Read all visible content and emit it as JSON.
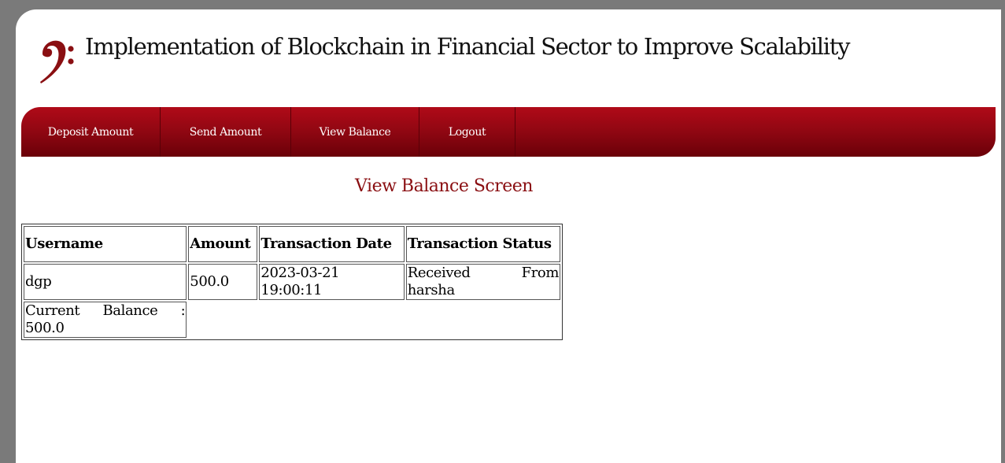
{
  "header": {
    "title": "Implementation of Blockchain in Financial Sector to Improve Scalability",
    "logo_icon": "bass-clef-icon",
    "accent_color": "#8a0f12"
  },
  "nav": {
    "items": [
      {
        "label": "Deposit Amount"
      },
      {
        "label": "Send Amount"
      },
      {
        "label": "View Balance"
      },
      {
        "label": "Logout"
      }
    ],
    "bar_color": "#9a0810"
  },
  "main": {
    "heading": "View Balance Screen",
    "table": {
      "columns": [
        "Username",
        "Amount",
        "Transaction Date",
        "Transaction Status"
      ],
      "rows": [
        [
          "dgp",
          "500.0",
          "2023-03-21 19:00:11",
          "Received From harsha"
        ]
      ],
      "footer": "Current Balance : 500.0"
    }
  }
}
